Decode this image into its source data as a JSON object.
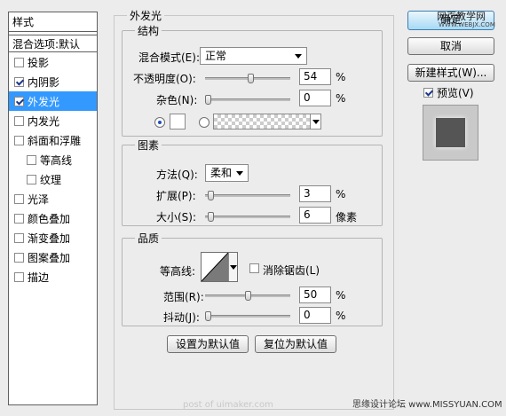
{
  "style_list": {
    "header": "样式",
    "blend_options": "混合选项:默认",
    "items": [
      {
        "label": "投影",
        "checked": false
      },
      {
        "label": "内阴影",
        "checked": true
      },
      {
        "label": "外发光",
        "checked": true,
        "selected": true
      },
      {
        "label": "内发光",
        "checked": false
      },
      {
        "label": "斜面和浮雕",
        "checked": false
      },
      {
        "label": "等高线",
        "checked": false,
        "indent": true
      },
      {
        "label": "纹理",
        "checked": false,
        "indent": true
      },
      {
        "label": "光泽",
        "checked": false
      },
      {
        "label": "颜色叠加",
        "checked": false
      },
      {
        "label": "渐变叠加",
        "checked": false
      },
      {
        "label": "图案叠加",
        "checked": false
      },
      {
        "label": "描边",
        "checked": false
      }
    ]
  },
  "panel": {
    "title": "外发光",
    "structure": {
      "title": "结构",
      "blend_mode_label": "混合模式(E):",
      "blend_mode_value": "正常",
      "opacity_label": "不透明度(O):",
      "opacity_value": "54",
      "opacity_unit": "%",
      "opacity_level": 54,
      "noise_label": "杂色(N):",
      "noise_value": "0",
      "noise_unit": "%",
      "noise_level": 0,
      "color_mode": "solid",
      "glow_color": "#ffffff"
    },
    "elements": {
      "title": "图素",
      "method_label": "方法(Q):",
      "method_value": "柔和",
      "spread_label": "扩展(P):",
      "spread_value": "3",
      "spread_unit": "%",
      "spread_level": 3,
      "size_label": "大小(S):",
      "size_value": "6",
      "size_unit": "像素"
    },
    "quality": {
      "title": "品质",
      "contour_label": "等高线:",
      "antialias_label": "消除锯齿(L)",
      "antialias_checked": false,
      "range_label": "范围(R):",
      "range_value": "50",
      "range_unit": "%",
      "range_level": 50,
      "jitter_label": "抖动(J):",
      "jitter_value": "0",
      "jitter_unit": "%",
      "jitter_level": 0
    },
    "make_default": "设置为默认值",
    "reset_default": "复位为默认值"
  },
  "buttons": {
    "ok": "确定",
    "cancel": "取消",
    "new_style": "新建样式(W)...",
    "preview_label": "预览(V)",
    "preview_checked": true
  },
  "watermarks": {
    "top_right": "网页教学网",
    "top_right_url": "WWW.WEBJX.COM",
    "bottom_center": "post of uimaker.com",
    "bottom_right": "思缘设计论坛 www.MISSYUAN.COM"
  }
}
